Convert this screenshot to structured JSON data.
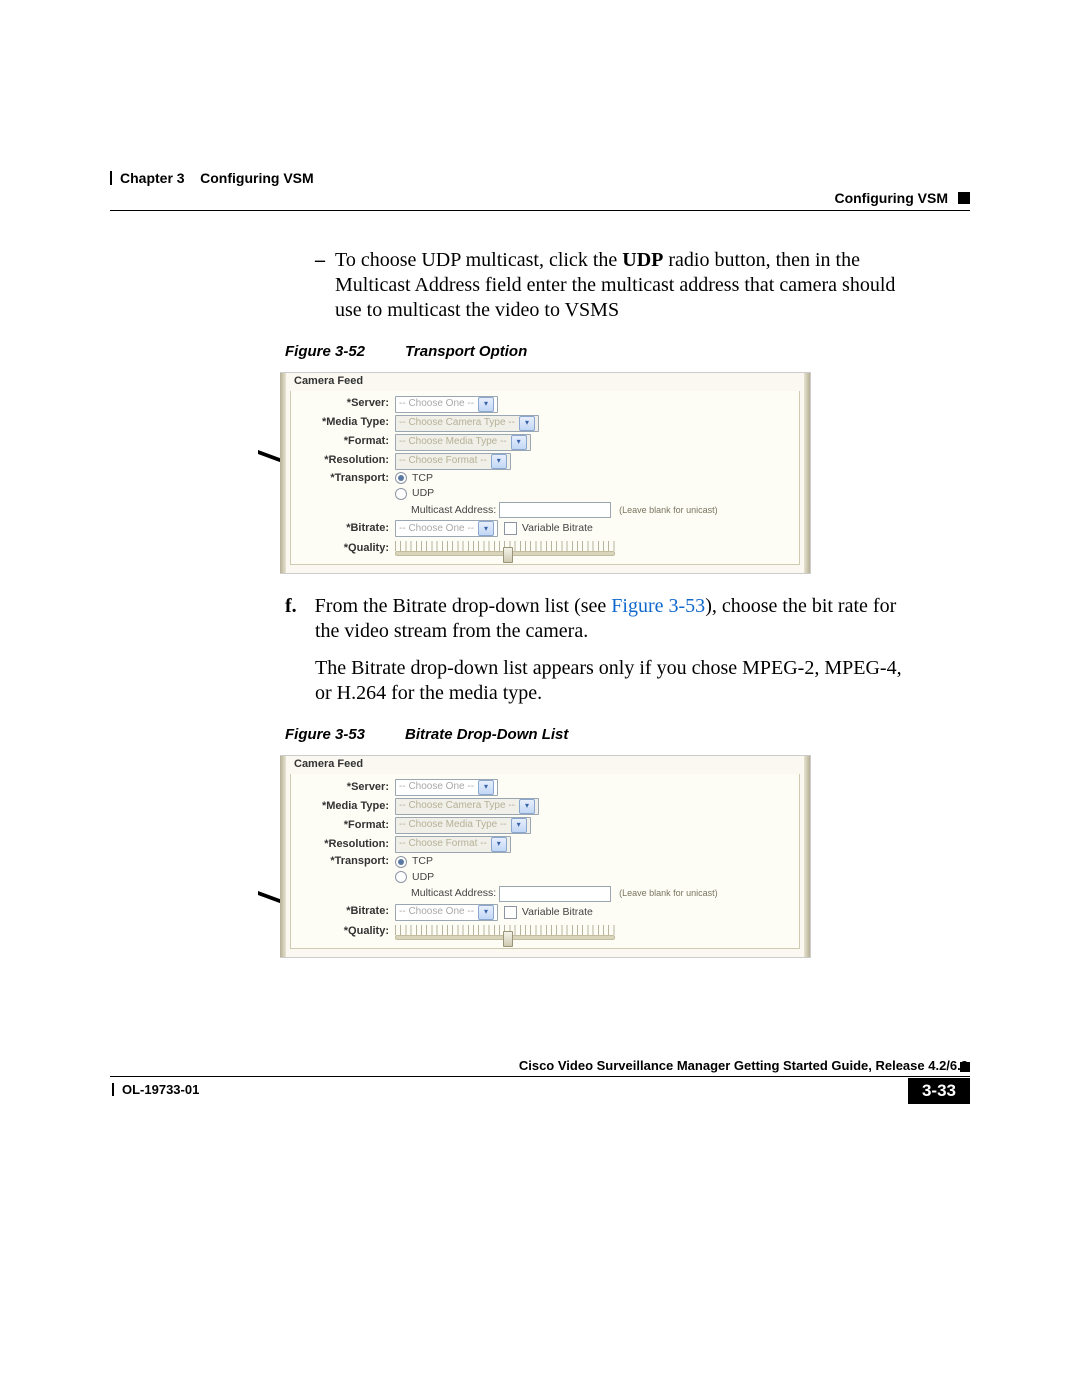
{
  "header": {
    "left_chapter": "Chapter 3",
    "left_title": "Configuring VSM",
    "right_title": "Configuring VSM"
  },
  "para1_before_udp": "To choose UDP multicast, click the ",
  "udp": "UDP",
  "para1_after_udp": " radio button, then in the Multicast Address field enter the multicast address that camera should use to multicast the video to VSMS",
  "fig52": {
    "num": "Figure 3-52",
    "title": "Transport Option"
  },
  "fig53": {
    "num": "Figure 3-53",
    "title": "Bitrate Drop-Down List"
  },
  "form": {
    "legend": "Camera Feed",
    "labels": {
      "server": "*Server:",
      "media_type": "*Media Type:",
      "format": "*Format:",
      "resolution": "*Resolution:",
      "transport": "*Transport:",
      "bitrate": "*Bitrate:",
      "quality": "*Quality:"
    },
    "values": {
      "choose_one": "-- Choose One --",
      "choose_camera": "-- Choose Camera Type --",
      "choose_media": "-- Choose Media Type --",
      "choose_format": "-- Choose Format --",
      "tcp": "TCP",
      "udp": "UDP",
      "multicast_address": "Multicast Address:",
      "blank_hint": "(Leave blank for unicast)",
      "variable_bitrate": "Variable Bitrate"
    }
  },
  "step_f_letter": "f.",
  "step_f_before_link": "From the Bitrate drop-down list (see ",
  "step_f_link": "Figure 3-53",
  "step_f_after_link": "), choose the bit rate for the video stream from the camera.",
  "step_f_followup": "The Bitrate drop-down list appears only if you chose MPEG-2, MPEG-4, or H.264 for the media type.",
  "footer": {
    "guide_title": "Cisco Video Surveillance Manager Getting Started Guide, Release 4.2/6.2",
    "doc_id": "OL-19733-01",
    "page_num": "3-33"
  }
}
